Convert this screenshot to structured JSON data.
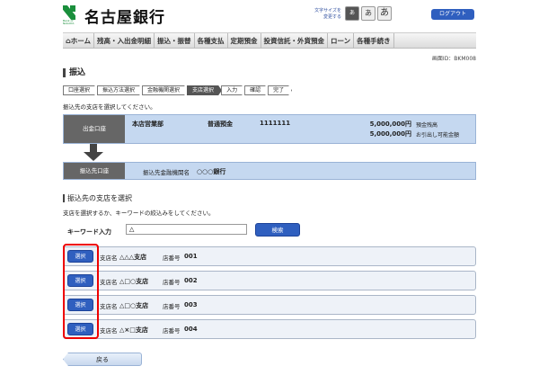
{
  "header": {
    "bank_name": "名古屋銀行",
    "logo_sub": "Bank of NAGOYA",
    "font_size_label_1": "文字サイズを",
    "font_size_label_2": "変更する",
    "font_buttons": [
      "あ",
      "あ",
      "あ"
    ],
    "logout": "ログアウト"
  },
  "nav": {
    "items": [
      "ホーム",
      "残高・入出金明細",
      "振込・振替",
      "各種支払",
      "定期預金",
      "投資信託・外貨預金",
      "ローン",
      "各種手続き"
    ]
  },
  "screen_id": "画面ID：BKM008",
  "page_title": "振込",
  "steps": [
    "口座選択",
    "振込方法選択",
    "金融機関選択",
    "支店選択",
    "入力",
    "確認",
    "完了"
  ],
  "instruction": "振込先の支店を選択してください。",
  "from_account": {
    "label": "出金口座",
    "branch": "本店営業部",
    "type": "普通預金",
    "number": "1111111",
    "balance": "5,000,000円",
    "balance_label": "預金残高",
    "available": "5,000,000円",
    "available_label": "お引出し可能金額"
  },
  "to_account": {
    "label": "振込先口座",
    "bank_label": "振込先金融機関名",
    "bank_name": "○○○銀行"
  },
  "branch_section": {
    "title": "振込先の支店を選択",
    "desc": "支店を選択するか、キーワードの絞込みをしてください。",
    "keyword_label": "キーワード入力",
    "keyword_value": "△",
    "search_label": "検索",
    "branch_name_label": "支店名",
    "branch_no_label": "店番号",
    "select_label": "選択",
    "branches": [
      {
        "name": "△△△支店",
        "no": "001"
      },
      {
        "name": "△□○支店",
        "no": "002"
      },
      {
        "name": "△□○支店",
        "no": "003"
      },
      {
        "name": "△×□支店",
        "no": "004"
      }
    ]
  },
  "back_label": "戻る",
  "colors": {
    "accent": "#2f5fbf",
    "highlight": "#e00000",
    "panel": "#c5d8f0"
  }
}
